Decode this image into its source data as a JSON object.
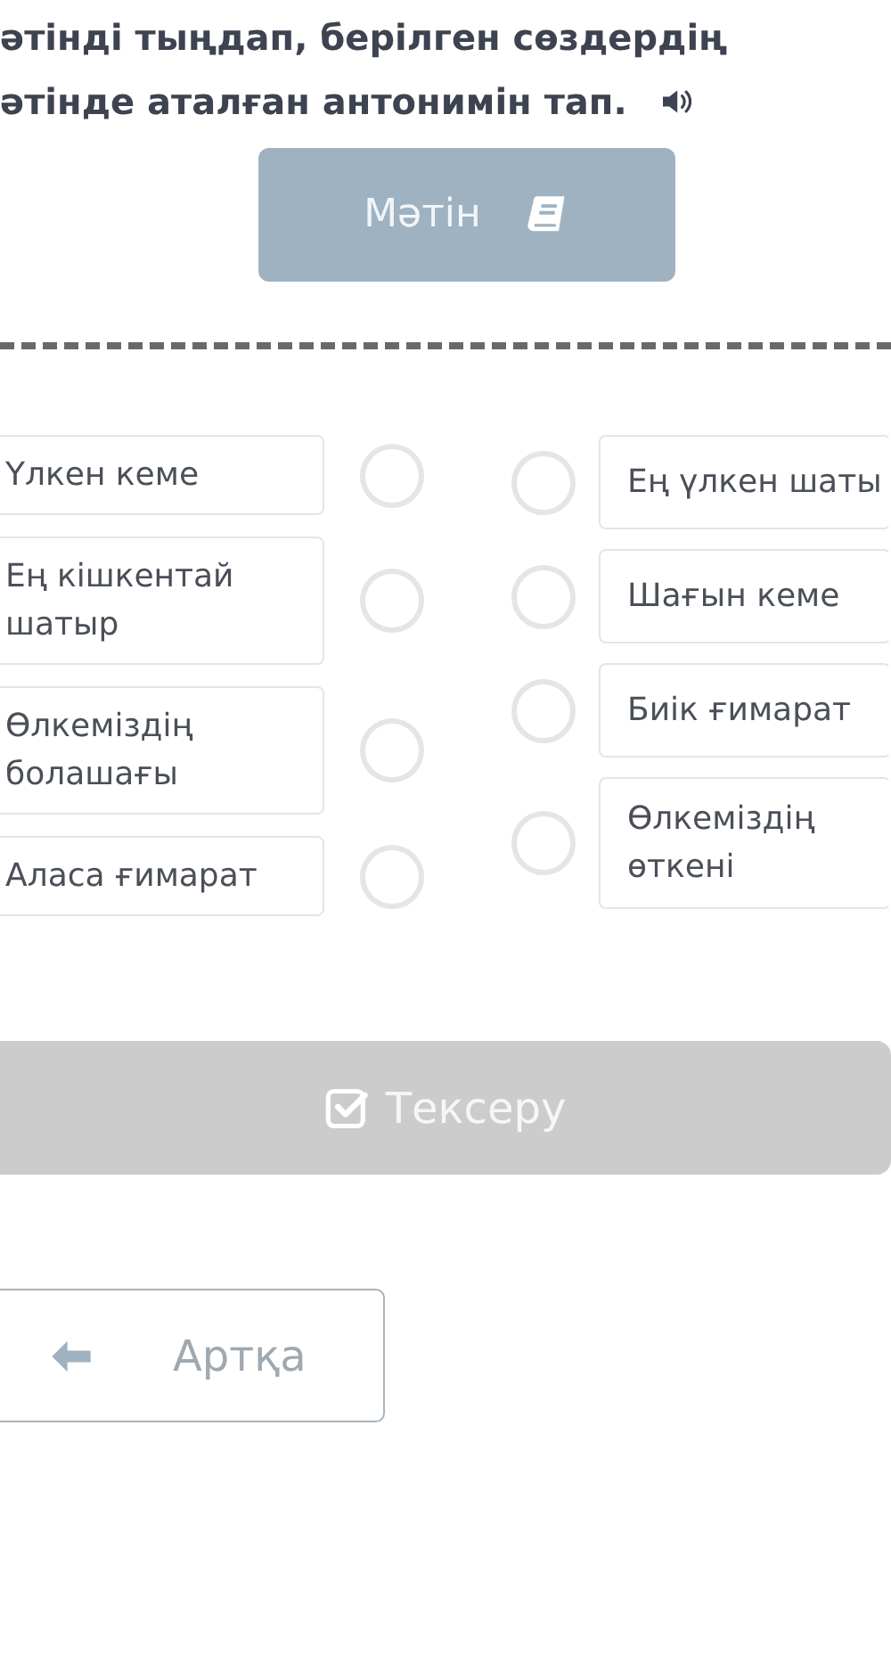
{
  "title_lines": [
    "әтінді тыңдап, берілген сөздердің",
    "әтінде аталған антонимін тап."
  ],
  "text_button": {
    "label": "Мәтін"
  },
  "left_items": [
    {
      "text": "Үлкен кеме",
      "selected": false
    },
    {
      "text": "Ең кішкентай шатыр",
      "selected": false
    },
    {
      "text": "Өлкеміздің болашағы",
      "selected": false
    },
    {
      "text": "Аласа ғимарат",
      "selected": false
    }
  ],
  "right_items": [
    {
      "text": "Ең үлкен шаты",
      "selected": false
    },
    {
      "text": "Шағын кеме",
      "selected": false
    },
    {
      "text": "Биік ғимарат",
      "selected": false
    },
    {
      "text": "Өлкеміздің өткені",
      "selected": false
    }
  ],
  "check_button": {
    "label": "Тексеру",
    "disabled": true
  },
  "back_button": {
    "label": "Артқа"
  }
}
